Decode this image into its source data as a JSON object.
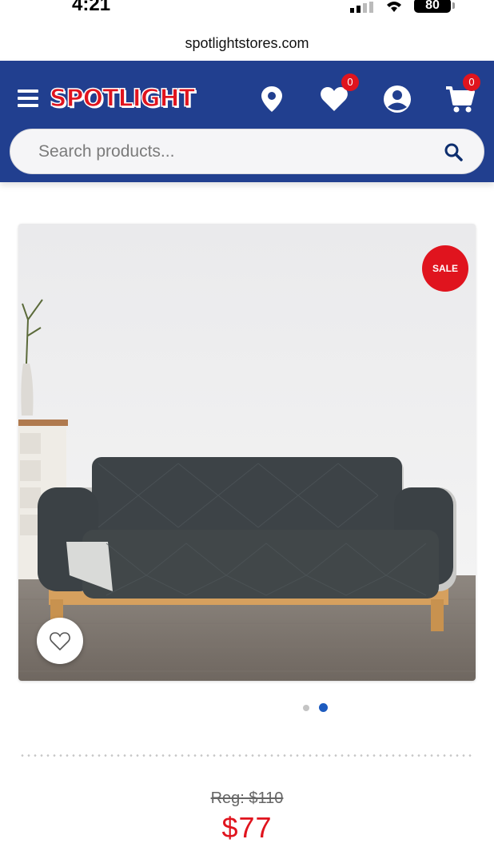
{
  "status_bar": {
    "time": "4:21",
    "battery": "80"
  },
  "browser": {
    "url": "spotlightstores.com"
  },
  "header": {
    "logo_text": "SPOTLIGHT",
    "wishlist_count": "0",
    "cart_count": "0",
    "icons": [
      "menu-icon",
      "store-location-icon",
      "heart-icon",
      "account-icon",
      "cart-icon"
    ]
  },
  "search": {
    "placeholder": "Search products..."
  },
  "product": {
    "sale_badge": "SALE",
    "image_description_icons": [
      "sofa-cover-photo"
    ],
    "carousel_total": 2,
    "carousel_active_index": 2,
    "reg_price": "Reg: $110",
    "sale_price": "$77"
  },
  "colors": {
    "brand_blue": "#213f8f",
    "brand_red": "#e0141e",
    "active_dot": "#1d5bbf"
  }
}
